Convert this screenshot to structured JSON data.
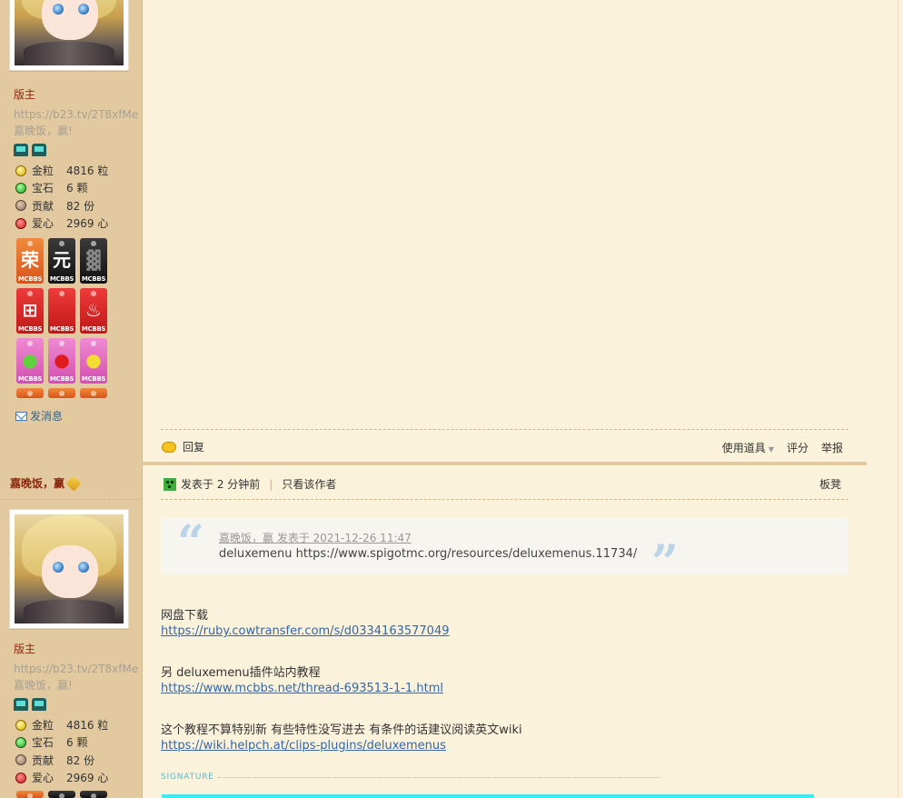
{
  "post1": {
    "sidebar": {
      "rank": "版主",
      "sig_line1": "https://b23.tv/2T8xfMe",
      "sig_line2": "嘉晚饭，赢!",
      "stats": [
        {
          "label": "金粒",
          "value": "4816 粒",
          "icon": "gold-nugget-icon"
        },
        {
          "label": "宝石",
          "value": "6 颗",
          "icon": "emerald-icon"
        },
        {
          "label": "贡献",
          "value": "82 份",
          "icon": "contribution-icon"
        },
        {
          "label": "爱心",
          "value": "2969 心",
          "icon": "apple-heart-icon"
        }
      ],
      "medals": [
        {
          "sym": "荣",
          "tag": "MCBBS",
          "color": "orange"
        },
        {
          "sym": "元",
          "tag": "MCBBS",
          "color": "black"
        },
        {
          "sym": "▓",
          "tag": "MCBBS",
          "color": "black"
        },
        {
          "sym": "⊞",
          "tag": "MCBBS",
          "color": "red"
        },
        {
          "sym": "",
          "tag": "MCBBS",
          "color": "red"
        },
        {
          "sym": "♨",
          "tag": "MCBBS",
          "color": "red"
        },
        {
          "sym": "●",
          "tag": "MCBBS",
          "color": "pink",
          "symColor": "#5fd23b"
        },
        {
          "sym": "●",
          "tag": "MCBBS",
          "color": "pink",
          "symColor": "#e01b1b"
        },
        {
          "sym": "●",
          "tag": "MCBBS",
          "color": "pink",
          "symColor": "#f5dc32"
        }
      ],
      "send_message": "发消息"
    },
    "footer": {
      "reply": "回复",
      "use_tool": "使用道具",
      "rate": "评分",
      "report": "举报"
    }
  },
  "post2": {
    "author": "嘉晚饭，赢",
    "meta": {
      "posted": "发表于 2 分钟前",
      "only_author": "只看该作者",
      "floor": "板凳"
    },
    "sidebar": {
      "rank": "版主",
      "sig_line1": "https://b23.tv/2T8xfMe",
      "sig_line2": "嘉晚饭，赢!",
      "stats": [
        {
          "label": "金粒",
          "value": "4816 粒"
        },
        {
          "label": "宝石",
          "value": "6 颗"
        },
        {
          "label": "贡献",
          "value": "82 份"
        },
        {
          "label": "爱心",
          "value": "2969 心"
        }
      ]
    },
    "quote": {
      "by": "嘉晚饭，赢 发表于 2021-12-26 11:47",
      "text": "deluxemenu https://www.spigotmc.org/resources/deluxemenus.11734/"
    },
    "body": {
      "line1": "网盘下载",
      "link1": "https://ruby.cowtransfer.com/s/d0334163577049",
      "line2": "另 deluxemenu插件站内教程",
      "link2": "https://www.mcbbs.net/thread-693513-1-1.html",
      "line3": "这个教程不算特别新 有些特性没写进去 有条件的话建议阅读英文wiki",
      "link3": "https://wiki.helpch.at/clips-plugins/deluxemenus"
    },
    "signature_label": "SIGNATURE"
  },
  "colors": {
    "page_bg": "#fbf2db",
    "sidebar_bg": "#e3c99f",
    "rank": "#8b2a0f",
    "link": "#3366aa",
    "signature_bar": "#2ff0f5"
  }
}
